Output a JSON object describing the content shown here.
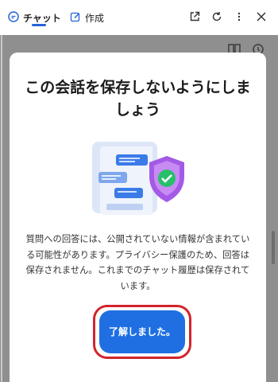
{
  "tabs": [
    {
      "label": "チャット",
      "icon": "chat-icon",
      "active": true
    },
    {
      "label": "作成",
      "icon": "compose-icon",
      "active": false
    }
  ],
  "toolbar_icons": [
    "open-external-icon",
    "refresh-icon",
    "more-icon",
    "close-icon"
  ],
  "dialog": {
    "title": "この会話を保存しないようにしましょう",
    "body": "質問への回答には、公開されていない情報が含まれている可能性があります。プライバシー保護のため、回答は保存されません。これまでのチャット履歴は保存されています。",
    "button_label": "了解しました。"
  },
  "colors": {
    "accent": "#1f6fe3",
    "highlight": "#d3232a",
    "backdrop": "#8f8f8f"
  }
}
